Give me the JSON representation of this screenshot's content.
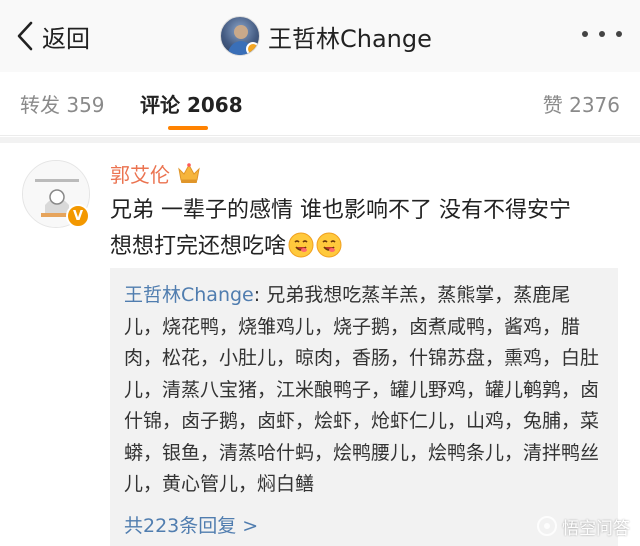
{
  "nav": {
    "back_label": "返回",
    "title": "王哲林Change",
    "back_icon": "chevron-left-icon",
    "more_icon": "more-dots-icon"
  },
  "tabs": {
    "repost": "转发 359",
    "comment": "评论 2068",
    "like": "赞 2376",
    "active": "comment",
    "accent_color": "#ff8200"
  },
  "comment": {
    "username": "郭艾伦",
    "username_color": "#eb7350",
    "badge_icon": "crown-icon",
    "verified_icon": "verified-v-icon",
    "verified_mark": "V",
    "text_line1": "兄弟 一辈子的感情 谁也影响不了 没有不得安宁",
    "text_line2": "想想打完还想吃啥",
    "emoji_icon": "yummy-face-emoji"
  },
  "reply": {
    "author": "王哲林Change",
    "separator": ": ",
    "text": "兄弟我想吃蒸羊羔，蒸熊掌，蒸鹿尾儿，烧花鸭，烧雏鸡儿，烧子鹅，卤煮咸鸭，酱鸡，腊肉，松花，小肚儿，晾肉，香肠，什锦苏盘，熏鸡，白肚儿，清蒸八宝猪，江米酿鸭子，罐儿野鸡，罐儿鹌鹑，卤什锦，卤子鹅，卤虾，烩虾，炝虾仁儿，山鸡，兔脯，菜蟒，银鱼，清蒸哈什蚂，烩鸭腰儿，烩鸭条儿，清拌鸭丝儿，黄心管儿，焖白鳝",
    "more_label": "共223条回复 >",
    "link_color": "#507daf"
  },
  "watermark": {
    "text": "悟空问答"
  }
}
